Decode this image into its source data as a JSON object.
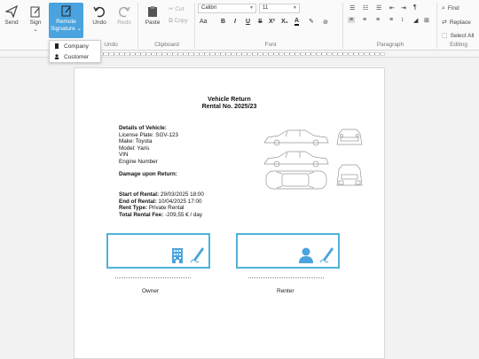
{
  "toolbar": {
    "send": "Send",
    "sign": "Sign",
    "sign_caret": "⌄",
    "remote": "Remote",
    "remote2": "Signature",
    "remote_caret": "⌄",
    "undo": "Undo",
    "redo": "Redo",
    "paste": "Paste",
    "cut": "Cut",
    "copy": "Copy"
  },
  "groups": {
    "undo": "Undo",
    "clipboard": "Clipboard",
    "font": "Font",
    "paragraph": "Paragraph",
    "editing": "Editing"
  },
  "font": {
    "family": "Calibri",
    "size": "11",
    "grow": "Aa",
    "bold": "B",
    "italic": "I",
    "underline": "U",
    "strike": "S",
    "superscript": "X²",
    "subscript": "X₂"
  },
  "editing": {
    "find": "Find",
    "replace": "Replace",
    "select_all": "Select All"
  },
  "menu": {
    "items": [
      "Company",
      "Customer"
    ]
  },
  "document": {
    "title1": "Vehicle Return",
    "title2": "Rental No. 2025/23",
    "details_heading": "Details of Vehicle:",
    "plate": "License Plate: SGV-123",
    "make": "Make: Toyota",
    "model": "Model: Yaris",
    "vin": "VIN",
    "engine": "Engine Number",
    "damage_heading": "Damage upon Return:",
    "start_label": "Start of Rental:",
    "start_value": " 29/03/2025 18:00",
    "end_label": "End of Rental:",
    "end_value": " 10/04/2025 17:00",
    "type_label": "Rent Type:",
    "type_value": " Private Rental",
    "fee_label": "Total Rental Fee:",
    "fee_value": " -209,55 € / day",
    "owner": "Owner",
    "renter": "Renter"
  },
  "colors": {
    "accent": "#4aa3df",
    "signature_border": "#4fb3d9"
  }
}
